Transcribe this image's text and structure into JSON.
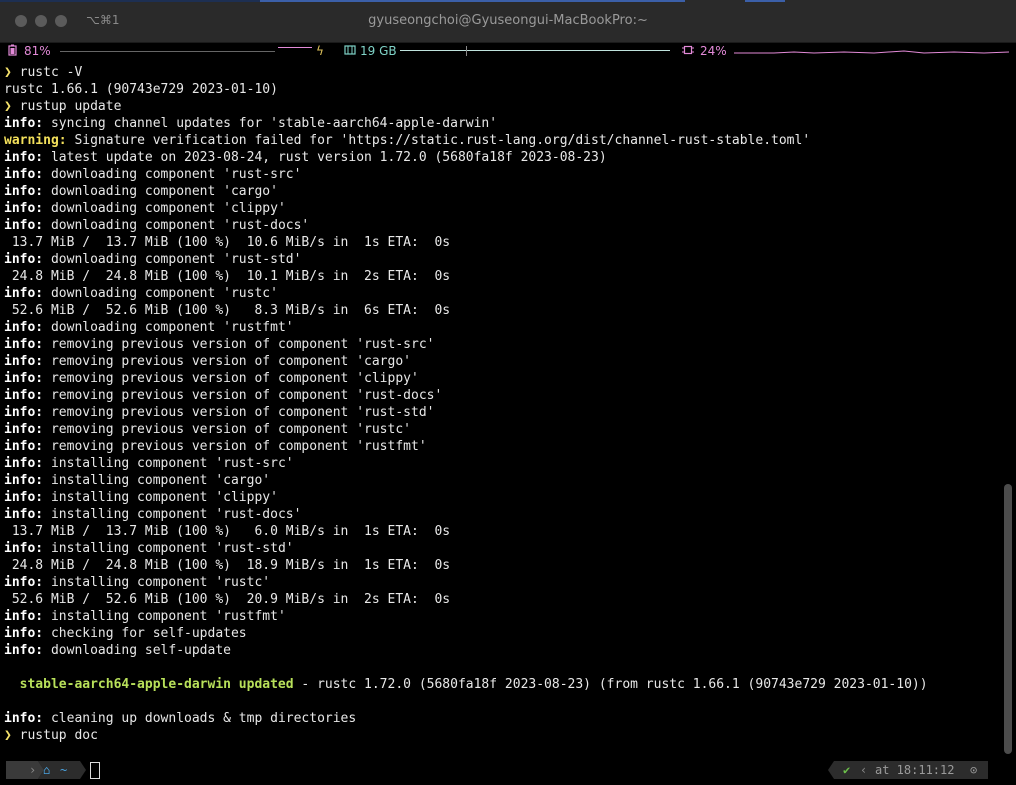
{
  "window": {
    "title": "gyuseongchoi@Gyuseongui-MacBookPro:~",
    "tab_shortcut": "⌥⌘1"
  },
  "status": {
    "battery_icon": "battery-icon",
    "battery": "81%",
    "charging_icon": "bolt-icon",
    "memory_icon": "memory-icon",
    "memory": "19 GB",
    "cpu_icon": "cpu-icon",
    "cpu": "24%",
    "colors": {
      "battery": "#e38ad8",
      "memory": "#7fd3c7",
      "cpu": "#e38ad8"
    }
  },
  "terminal": {
    "lines": [
      {
        "parts": [
          {
            "t": "❯ ",
            "c": "prompt"
          },
          {
            "t": "rustc -V"
          }
        ]
      },
      {
        "parts": [
          {
            "t": "rustc 1.66.1 (90743e729 2023-01-10)"
          }
        ]
      },
      {
        "parts": [
          {
            "t": "❯ ",
            "c": "prompt"
          },
          {
            "t": "rustup update"
          }
        ]
      },
      {
        "parts": [
          {
            "t": "info:",
            "c": "tag-info"
          },
          {
            "t": " syncing channel updates for 'stable-aarch64-apple-darwin'"
          }
        ]
      },
      {
        "parts": [
          {
            "t": "warning:",
            "c": "tag-warn"
          },
          {
            "t": " Signature verification failed for 'https://static.rust-lang.org/dist/channel-rust-stable.toml'"
          }
        ]
      },
      {
        "parts": [
          {
            "t": "info:",
            "c": "tag-info"
          },
          {
            "t": " latest update on 2023-08-24, rust version 1.72.0 (5680fa18f 2023-08-23)"
          }
        ]
      },
      {
        "parts": [
          {
            "t": "info:",
            "c": "tag-info"
          },
          {
            "t": " downloading component 'rust-src'"
          }
        ]
      },
      {
        "parts": [
          {
            "t": "info:",
            "c": "tag-info"
          },
          {
            "t": " downloading component 'cargo'"
          }
        ]
      },
      {
        "parts": [
          {
            "t": "info:",
            "c": "tag-info"
          },
          {
            "t": " downloading component 'clippy'"
          }
        ]
      },
      {
        "parts": [
          {
            "t": "info:",
            "c": "tag-info"
          },
          {
            "t": " downloading component 'rust-docs'"
          }
        ]
      },
      {
        "parts": [
          {
            "t": " 13.7 MiB /  13.7 MiB (100 %)  10.6 MiB/s in  1s ETA:  0s"
          }
        ]
      },
      {
        "parts": [
          {
            "t": "info:",
            "c": "tag-info"
          },
          {
            "t": " downloading component 'rust-std'"
          }
        ]
      },
      {
        "parts": [
          {
            "t": " 24.8 MiB /  24.8 MiB (100 %)  10.1 MiB/s in  2s ETA:  0s"
          }
        ]
      },
      {
        "parts": [
          {
            "t": "info:",
            "c": "tag-info"
          },
          {
            "t": " downloading component 'rustc'"
          }
        ]
      },
      {
        "parts": [
          {
            "t": " 52.6 MiB /  52.6 MiB (100 %)   8.3 MiB/s in  6s ETA:  0s"
          }
        ]
      },
      {
        "parts": [
          {
            "t": "info:",
            "c": "tag-info"
          },
          {
            "t": " downloading component 'rustfmt'"
          }
        ]
      },
      {
        "parts": [
          {
            "t": "info:",
            "c": "tag-info"
          },
          {
            "t": " removing previous version of component 'rust-src'"
          }
        ]
      },
      {
        "parts": [
          {
            "t": "info:",
            "c": "tag-info"
          },
          {
            "t": " removing previous version of component 'cargo'"
          }
        ]
      },
      {
        "parts": [
          {
            "t": "info:",
            "c": "tag-info"
          },
          {
            "t": " removing previous version of component 'clippy'"
          }
        ]
      },
      {
        "parts": [
          {
            "t": "info:",
            "c": "tag-info"
          },
          {
            "t": " removing previous version of component 'rust-docs'"
          }
        ]
      },
      {
        "parts": [
          {
            "t": "info:",
            "c": "tag-info"
          },
          {
            "t": " removing previous version of component 'rust-std'"
          }
        ]
      },
      {
        "parts": [
          {
            "t": "info:",
            "c": "tag-info"
          },
          {
            "t": " removing previous version of component 'rustc'"
          }
        ]
      },
      {
        "parts": [
          {
            "t": "info:",
            "c": "tag-info"
          },
          {
            "t": " removing previous version of component 'rustfmt'"
          }
        ]
      },
      {
        "parts": [
          {
            "t": "info:",
            "c": "tag-info"
          },
          {
            "t": " installing component 'rust-src'"
          }
        ]
      },
      {
        "parts": [
          {
            "t": "info:",
            "c": "tag-info"
          },
          {
            "t": " installing component 'cargo'"
          }
        ]
      },
      {
        "parts": [
          {
            "t": "info:",
            "c": "tag-info"
          },
          {
            "t": " installing component 'clippy'"
          }
        ]
      },
      {
        "parts": [
          {
            "t": "info:",
            "c": "tag-info"
          },
          {
            "t": " installing component 'rust-docs'"
          }
        ]
      },
      {
        "parts": [
          {
            "t": " 13.7 MiB /  13.7 MiB (100 %)   6.0 MiB/s in  1s ETA:  0s"
          }
        ]
      },
      {
        "parts": [
          {
            "t": "info:",
            "c": "tag-info"
          },
          {
            "t": " installing component 'rust-std'"
          }
        ]
      },
      {
        "parts": [
          {
            "t": " 24.8 MiB /  24.8 MiB (100 %)  18.9 MiB/s in  1s ETA:  0s"
          }
        ]
      },
      {
        "parts": [
          {
            "t": "info:",
            "c": "tag-info"
          },
          {
            "t": " installing component 'rustc'"
          }
        ]
      },
      {
        "parts": [
          {
            "t": " 52.6 MiB /  52.6 MiB (100 %)  20.9 MiB/s in  2s ETA:  0s"
          }
        ]
      },
      {
        "parts": [
          {
            "t": "info:",
            "c": "tag-info"
          },
          {
            "t": " installing component 'rustfmt'"
          }
        ]
      },
      {
        "parts": [
          {
            "t": "info:",
            "c": "tag-info"
          },
          {
            "t": " checking for self-updates"
          }
        ]
      },
      {
        "parts": [
          {
            "t": "info:",
            "c": "tag-info"
          },
          {
            "t": " downloading self-update"
          }
        ]
      },
      {
        "parts": [
          {
            "t": ""
          }
        ]
      },
      {
        "parts": [
          {
            "t": "  "
          },
          {
            "t": "stable-aarch64-apple-darwin updated",
            "c": "green"
          },
          {
            "t": " - rustc 1.72.0 (5680fa18f 2023-08-23) (from rustc 1.66.1 (90743e729 2023-01-10))"
          }
        ]
      },
      {
        "parts": [
          {
            "t": ""
          }
        ]
      },
      {
        "parts": [
          {
            "t": "info:",
            "c": "tag-info"
          },
          {
            "t": " cleaning up downloads & tmp directories"
          }
        ]
      },
      {
        "parts": [
          {
            "t": "❯ ",
            "c": "prompt"
          },
          {
            "t": "rustup doc"
          }
        ]
      }
    ]
  },
  "prompt_bar": {
    "apple_icon": "apple-icon",
    "home_icon": "home-icon",
    "path": "~",
    "check": "✔",
    "time": "at 18:11:12",
    "clock_icon": "clock-icon"
  }
}
